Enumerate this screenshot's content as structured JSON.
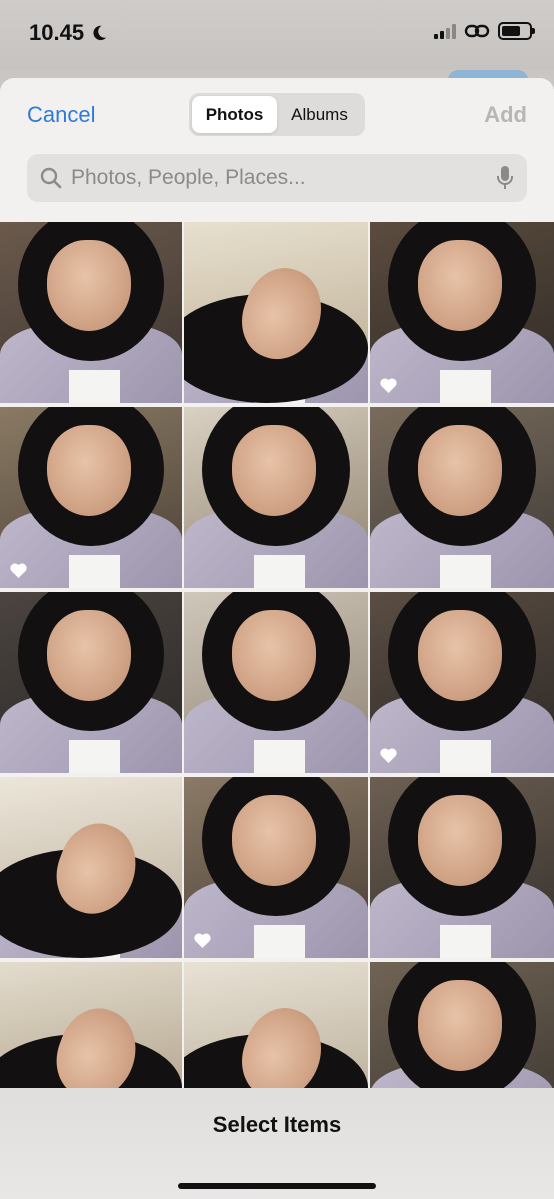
{
  "status": {
    "time": "10.45"
  },
  "header": {
    "cancel_label": "Cancel",
    "tabs": [
      {
        "label": "Photos",
        "active": true
      },
      {
        "label": "Albums",
        "active": false
      }
    ],
    "add_label": "Add"
  },
  "search": {
    "placeholder": "Photos, People, Places..."
  },
  "photos": [
    {
      "favorite": false
    },
    {
      "favorite": false
    },
    {
      "favorite": true
    },
    {
      "favorite": true
    },
    {
      "favorite": false
    },
    {
      "favorite": false
    },
    {
      "favorite": false
    },
    {
      "favorite": false
    },
    {
      "favorite": true
    },
    {
      "favorite": false
    },
    {
      "favorite": true
    },
    {
      "favorite": false
    },
    {
      "favorite": false
    },
    {
      "favorite": false
    },
    {
      "favorite": false
    }
  ],
  "bottom": {
    "title": "Select Items"
  },
  "colors": {
    "accent": "#2f7ad8",
    "disabled": "#b7b6b5",
    "sheet_bg": "#f2f1f0"
  },
  "icons": [
    "moon-icon",
    "signal-icon",
    "link-icon",
    "battery-icon",
    "search-icon",
    "mic-icon",
    "heart-icon"
  ]
}
